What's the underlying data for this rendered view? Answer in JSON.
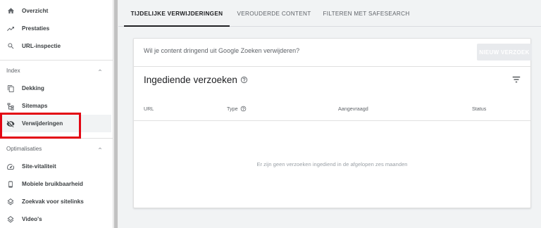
{
  "sidebar": {
    "items_top": [
      {
        "label": "Overzicht",
        "icon": "home-icon"
      },
      {
        "label": "Prestaties",
        "icon": "trending-up-icon"
      },
      {
        "label": "URL-inspectie",
        "icon": "search-icon"
      }
    ],
    "sections": [
      {
        "title": "Index",
        "items": [
          {
            "label": "Dekking",
            "icon": "copy-icon"
          },
          {
            "label": "Sitemaps",
            "icon": "sitemap-icon"
          },
          {
            "label": "Verwijderingen",
            "icon": "eye-off-icon",
            "active": true
          }
        ]
      },
      {
        "title": "Optimalisaties",
        "items": [
          {
            "label": "Site-vitaliteit",
            "icon": "speed-icon"
          },
          {
            "label": "Mobiele bruikbaarheid",
            "icon": "phone-icon"
          },
          {
            "label": "Zoekvak voor sitelinks",
            "icon": "layers-icon"
          },
          {
            "label": "Video's",
            "icon": "layers-icon"
          }
        ]
      }
    ]
  },
  "tabs": [
    {
      "label": "TIJDELIJKE VERWIJDERINGEN",
      "active": true
    },
    {
      "label": "VEROUDERDE CONTENT",
      "active": false
    },
    {
      "label": "FILTEREN MET SAFESEARCH",
      "active": false
    }
  ],
  "card": {
    "question": "Wil je content dringend uit Google Zoeken verwijderen?",
    "new_button": "NIEUW VERZOEK",
    "title": "Ingediende verzoeken",
    "columns": [
      "URL",
      "Type",
      "Aangevraagd",
      "Status"
    ],
    "empty_text": "Er zijn geen verzoeken ingediend in de afgelopen zes maanden"
  },
  "colors": {
    "highlight": "#e30613",
    "active_tab": "#202124",
    "disabled_button": "#e8eaed"
  }
}
